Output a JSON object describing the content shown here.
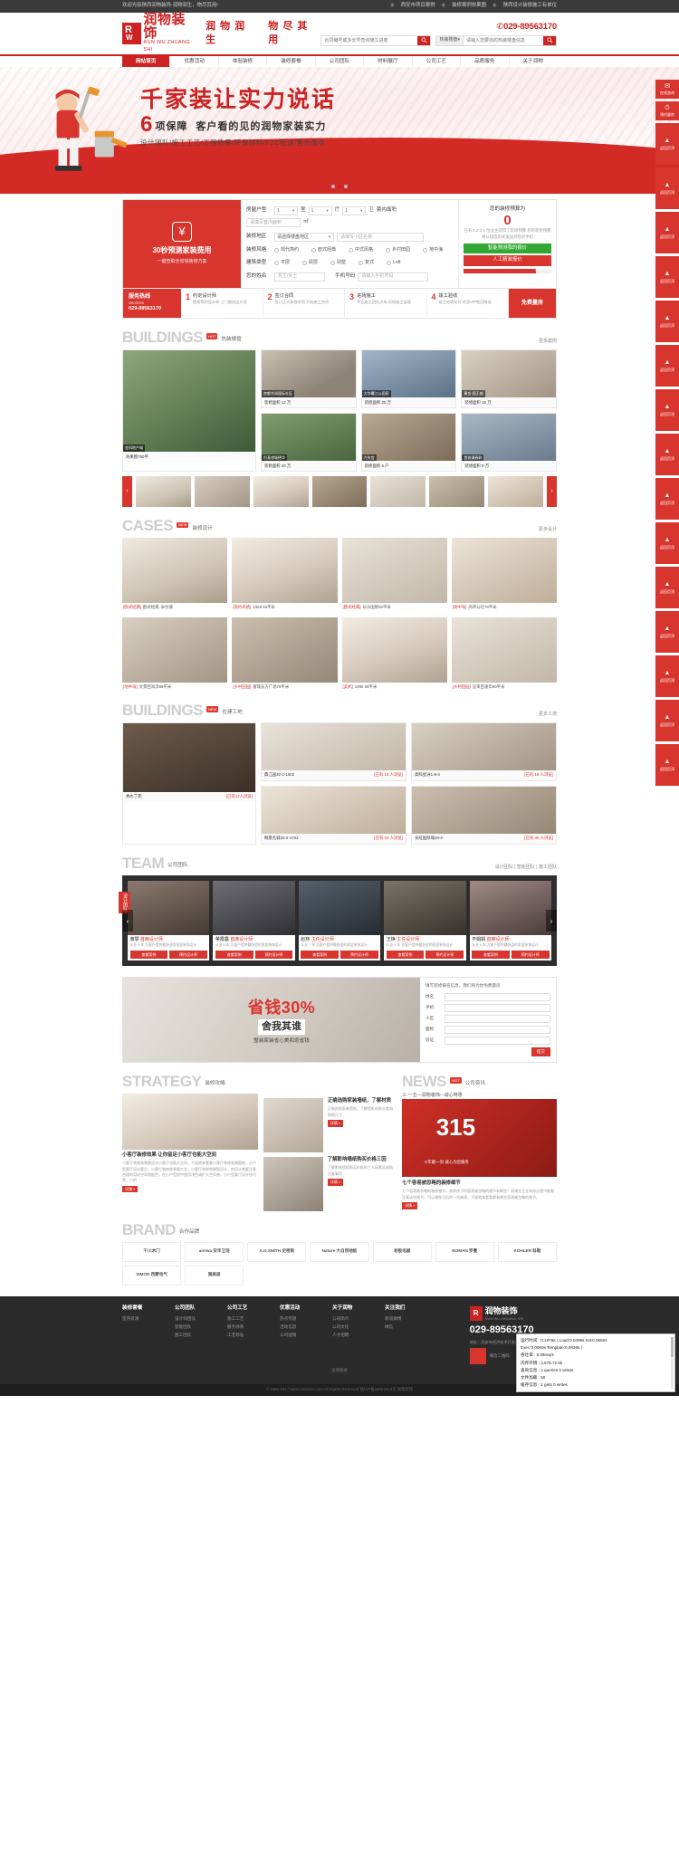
{
  "topbar": {
    "welcome": "欢迎光临陕西润物装饰-润物润生，物尽其用!",
    "links": [
      "西安市项目案例",
      "装修案例效果图",
      "陕西设计装修施工有单位"
    ]
  },
  "header": {
    "logo_cn": "润物装饰",
    "logo_en": "RUN WU ZHUANG SHI",
    "slogans": [
      "润 物 润 生",
      "物 尽 其 用"
    ],
    "phone": "029-89563170",
    "search1_placeholder": "合同编号或多长号查询施工进度",
    "search2_category": "热装楼盘",
    "search2_placeholder": "请输入您要找的热装楼盘信息"
  },
  "nav": {
    "items": [
      {
        "label": "网站首页",
        "active": true
      },
      {
        "label": "优惠活动",
        "active": false
      },
      {
        "label": "体验装修",
        "active": false
      },
      {
        "label": "装修套餐",
        "active": false
      },
      {
        "label": "公司团队",
        "active": false
      },
      {
        "label": "材料展厅",
        "active": false
      },
      {
        "label": "公司工艺",
        "active": false
      },
      {
        "label": "品质服务",
        "active": false
      },
      {
        "label": "关于润物",
        "active": false
      }
    ]
  },
  "banner": {
    "line1": "千家装让实力说话",
    "number": "6",
    "line2": "项保障",
    "line2b": "客户看的见的润物家装实力",
    "line3": "设计团队/施工工艺/工程质量/环保材料/F2C配送/售后服务",
    "dots": 3,
    "active_dot": 1
  },
  "quote": {
    "left_title": "30秒预测家装费用",
    "left_sub": "一键查取全省钱装修方案",
    "rows": {
      "huxing_label": "房屋户型",
      "shi": "1",
      "shi_unit": "室",
      "ting": "1",
      "ting_unit": "厅",
      "wei": "1",
      "wei_unit": "卫",
      "area_label": "套内面积",
      "area_placeholder": "请填写套内面积",
      "area_unit": "㎡",
      "district_label": "装修地区",
      "district_placeholder": "请选择楼盘地区",
      "xiaoqu_placeholder": "请填写小区名称",
      "style_label": "装修风格",
      "styles": [
        "现代简约",
        "欧式经典",
        "中式风格",
        "乡村田园",
        "地中海"
      ],
      "type_label": "建筑类型",
      "types": [
        "平层",
        "跃层",
        "别墅",
        "复式",
        "Loft"
      ],
      "name_label": "您的姓名",
      "name_placeholder": "先生/女士",
      "phone_label": "手机号码",
      "phone_placeholder": "请输入手机号码"
    },
    "right": {
      "title": "您的装修预算为",
      "amount": "0",
      "note": "已有 1,2 3 6 位业主获得了装修预算\n您的装修预算将以短信形式发送到您的手机",
      "btn_green": "智能预测我的报价",
      "btn_red": "人工精准报价",
      "progress_label": "0.8187%"
    }
  },
  "services": {
    "first_a": "服务热线",
    "first_b": "Services",
    "phone": "029-89563170",
    "items": [
      {
        "n": "1",
        "t": "约定设计师",
        "d": "提前预约设计师\n上门量房出方案"
      },
      {
        "n": "2",
        "t": "签订合同",
        "d": "签订正式装修合同\n开始施工合作"
      },
      {
        "n": "3",
        "t": "进场施工",
        "d": "专业施工团队进场\n现场施工监理"
      },
      {
        "n": "4",
        "t": "竣工验收",
        "d": "竣工验收交付\n终身VIP售后服务"
      }
    ],
    "last": "免费量房"
  },
  "buildings1": {
    "title": "BUILDINGS",
    "tag": "HOT",
    "sub": "热装楼盘",
    "more": "更多案例",
    "featured": {
      "name": "金科地产城",
      "price": "效果图750平"
    },
    "items": [
      {
        "name": "房都华润国际社区",
        "price": "装修面积 12 万"
      },
      {
        "name": "大华曙江公园家",
        "price": "装修面积 20 万"
      },
      {
        "name": "黄金·国王城",
        "price": "装修面积 16 万"
      },
      {
        "name": "恒基望塘德华",
        "price": "装修面积 20 万"
      },
      {
        "name": "兴庆宫",
        "price": "装修面积 5 户"
      },
      {
        "name": "首创漫春彰",
        "price": "装修面积 9 万"
      }
    ]
  },
  "cases": {
    "title": "CASES",
    "tag": "NEW",
    "sub": "装修设计",
    "more": "更多设计",
    "items": [
      {
        "style": "[欧式经典]",
        "name": "欧式经典",
        "area": "米尔城"
      },
      {
        "style": "[简约风格]",
        "name": "1958 50平米",
        "area": ""
      },
      {
        "style": "[欧式经典]",
        "name": "长乐国际50平米",
        "area": ""
      },
      {
        "style": "[地中海]",
        "name": "高单公社78平米",
        "area": ""
      },
      {
        "style": "[地中海]",
        "name": "文景西海淳89平米",
        "area": ""
      },
      {
        "style": "[乡村田园]",
        "name": "富瑞东方广场79平米",
        "area": ""
      },
      {
        "style": "[美式]",
        "name": "1958 56平米",
        "area": ""
      },
      {
        "style": "[乡村田园]",
        "name": "呈来百速华90平米",
        "area": ""
      }
    ]
  },
  "buildings2": {
    "title": "BUILDINGS",
    "tag": "NEW",
    "sub": "在建工地",
    "more": "更多工地",
    "featured": {
      "name": "秀水丁苑",
      "status": "[已有12人浏览]"
    },
    "items": [
      {
        "name": "典江园32-2-1502",
        "status": "[已有 15 人浏览]"
      },
      {
        "name": "高科星洲1-8-4",
        "status": "[已有 18 人浏览]"
      },
      {
        "name": "颐景名城32-2-1702",
        "status": "[已有 20 人浏览]"
      },
      {
        "name": "长虹国际城33-2-",
        "status": "[已有 38 人浏览]"
      }
    ]
  },
  "team": {
    "title": "TEAM",
    "sub": "公司团队",
    "more": "设计团队 | 智能团队 | 施工团队",
    "side_label": "设计团队",
    "side_label2": "施工团队",
    "members": [
      {
        "name": "南慧",
        "role": "首席设计师",
        "desc": "从业 9 年\n为客户提供最舒适的家居装饰设计"
      },
      {
        "name": "荣霞露",
        "role": "首席设计师",
        "desc": "从业 8 年\n为客户提供最舒适的家居装饰设计"
      },
      {
        "name": "赵林",
        "role": "主任设计师",
        "desc": "从业 7 年\n为客户提供最舒适的家居装饰设计"
      },
      {
        "name": "王铮",
        "role": "主任设计师",
        "desc": "从业 6 年\n为客户提供最舒适的家居装饰设计"
      },
      {
        "name": "平娟娟",
        "role": "首席设计师",
        "desc": "从业 6 年\n为客户提供最舒适的家居装饰设计"
      }
    ],
    "btn1": "查看案例",
    "btn2": "预约设计师"
  },
  "promo": {
    "line1": "省钱30%",
    "line2": "舍我其谁",
    "line3": "整装家装省心美和愈省钱",
    "form_title": "填写装修报名信息，我们将为你免费量房",
    "fields": [
      {
        "label": "姓名",
        "value": ""
      },
      {
        "label": "手机",
        "value": ""
      },
      {
        "label": "小区",
        "value": ""
      },
      {
        "label": "面积",
        "value": ""
      },
      {
        "label": "验证",
        "value": ""
      }
    ],
    "submit": "提交"
  },
  "strategy": {
    "title": "STRATEGY",
    "sub": "装修攻略",
    "featured_title": "小客厅装修效果 让你留足小客厅也能大空间",
    "featured_text": "小客厅装修效果图设计小客厅也能大空间，下面就来看看小客厅装修效果图吧，小户型客厅设计要点，小客厅装修效果图大全，小客厅装修效果图设计，房设计就要注意合理利用好空间和配色，在小户型房中使用浅色调扩大空间感，小户型客厅设计技巧等，小的…",
    "items": [
      {
        "title": "正确选购家装墙纸，了解材质",
        "text": "正确选购家装墙纸，了解墙纸材质分类和规格尺寸…",
        "more": "详情 »"
      },
      {
        "title": "了解影响墙纸购买价格三因",
        "text": "了解影响墙纸购买价格的三大因素及选购注意事项…",
        "more": "详情 »"
      }
    ],
    "more_label": "详情 »"
  },
  "news": {
    "title": "NEWS",
    "tag": "HOT",
    "sub": "公司资讯",
    "banner_title": "三·一五—润物装饰—诚心特惠",
    "banner_big": "315",
    "banner_sub": "十年磨一剑·诚心为您服务",
    "featured_title": "七个容易被忽略的装修细节",
    "featured_text": "七个容易被忽略的装修细节，装修房子时容易被忽略的细节有哪些？如果业主在装修过程中能够注意这些细节，可以避免日后的一些麻烦。下面就来看看都有哪些容易被忽略的细节。",
    "detail": "详情 »"
  },
  "brand": {
    "title": "BRAND",
    "sub": "合作品牌",
    "items": [
      "千川木门",
      "annwa 安华卫浴",
      "A.O.SMITH 史密斯",
      "Nature 大自然地板",
      "老板电器",
      "ROMAN 罗曼",
      "KOHLER 科勒",
      "SIMON 西蒙电气",
      "雅美居"
    ]
  },
  "footer": {
    "columns": [
      {
        "h": "装修套餐",
        "links": [
          "室内装潢"
        ]
      },
      {
        "h": "公司团队",
        "links": [
          "设计师团队",
          "智能团队",
          "施工团队"
        ]
      },
      {
        "h": "公司工艺",
        "links": [
          "施工工艺",
          "服务体系",
          "工艺标准"
        ]
      },
      {
        "h": "优惠活动",
        "links": [
          "热点专题",
          "活动信息",
          "公司促销"
        ]
      },
      {
        "h": "关于润物",
        "links": [
          "公司简介",
          "公司文化",
          "人才招聘"
        ]
      },
      {
        "h": "关注我们",
        "links": [
          "新浪微博",
          "微信"
        ]
      }
    ],
    "logo_cn": "润物装饰",
    "logo_en": "RUN WU ZHUANG SHI",
    "phone": "029-89563170",
    "address": "地址：西安市经济技术开发区凤城一路与文景路十字",
    "weixin_label": "微信二维码",
    "bar": "友情链接",
    "copyright": "© 1999-2017 www.runwuzs.com All Rights Reserved 陕ICP备18001913号 润物装饰"
  },
  "rail": {
    "items": [
      {
        "icon": "✉",
        "label": "在线咨询"
      },
      {
        "icon": "⏱",
        "label": "预约量房"
      },
      {
        "icon": "▲",
        "label": "返回页顶"
      },
      {
        "icon": "▲",
        "label": "返回页顶"
      },
      {
        "icon": "▲",
        "label": "返回页顶"
      },
      {
        "icon": "▲",
        "label": "返回页顶"
      },
      {
        "icon": "▲",
        "label": "返回页顶"
      },
      {
        "icon": "▲",
        "label": "返回页顶"
      },
      {
        "icon": "▲",
        "label": "返回页顶"
      },
      {
        "icon": "▲",
        "label": "返回页顶"
      },
      {
        "icon": "▲",
        "label": "返回页顶"
      },
      {
        "icon": "▲",
        "label": "返回页顶"
      },
      {
        "icon": "▲",
        "label": "返回页顶"
      },
      {
        "icon": "▲",
        "label": "返回页顶"
      },
      {
        "icon": "▲",
        "label": "返回页顶"
      },
      {
        "icon": "▲",
        "label": "返回页顶"
      },
      {
        "icon": "▲",
        "label": "返回页顶"
      }
    ]
  },
  "debug": {
    "l1": "运行时间 : 0.1976s ( Load:0.0495s Init:0.0582s",
    "l2": "Exec:0.0060s Template:0.0838s )",
    "l3": "吞吐率 : 5.06req/s",
    "l4": "内存开销 : 3,576.72 kb",
    "l5": "查询信息 : 2 queries 0 writes",
    "l6": "文件加载 : 50",
    "l7": "缓存信息 : 1 gets 0 writes"
  }
}
